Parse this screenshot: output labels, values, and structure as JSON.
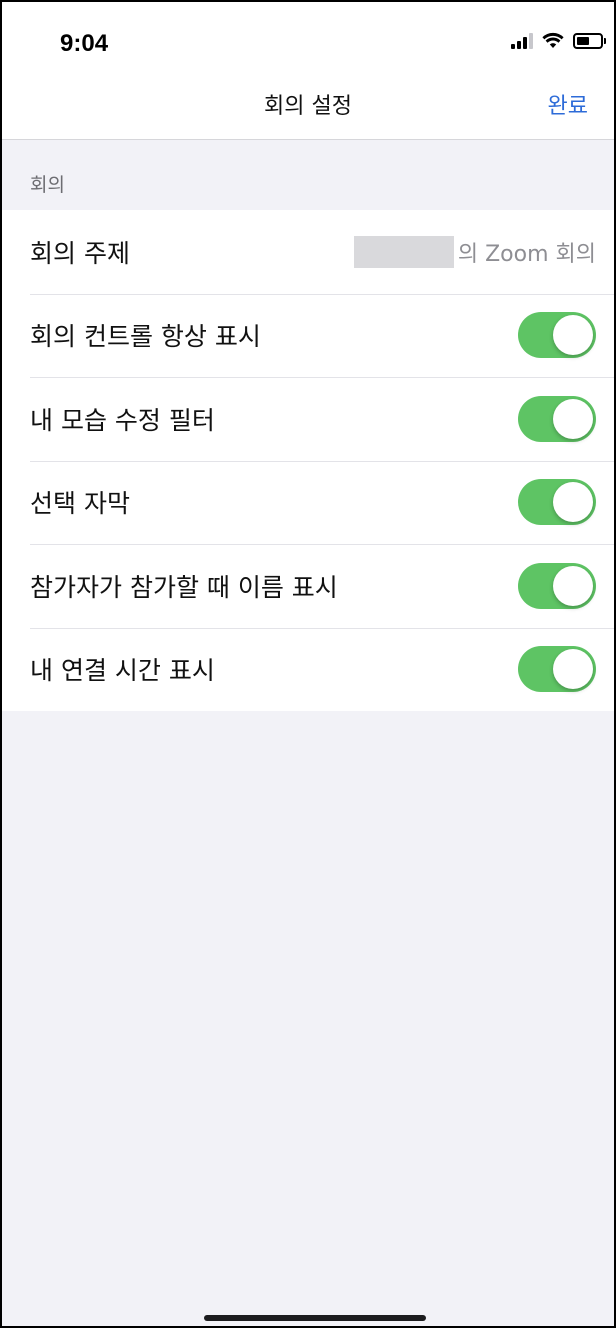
{
  "status_bar": {
    "time": "9:04",
    "icons": [
      "cellular-signal-icon",
      "wifi-icon",
      "battery-icon"
    ]
  },
  "nav": {
    "title": "회의 설정",
    "done_label": "완료"
  },
  "section": {
    "header": "회의"
  },
  "rows": [
    {
      "label": "회의 주제",
      "value": "의 Zoom 회의",
      "type": "value"
    },
    {
      "label": "회의 컨트롤 항상 표시",
      "type": "toggle",
      "on": true
    },
    {
      "label": "내 모습 수정 필터",
      "type": "toggle",
      "on": true
    },
    {
      "label": "선택 자막",
      "type": "toggle",
      "on": true
    },
    {
      "label": "참가자가 참가할 때 이름 표시",
      "type": "toggle",
      "on": true
    },
    {
      "label": "내 연결 시간 표시",
      "type": "toggle",
      "on": true
    }
  ],
  "colors": {
    "accent": "#2d6bd8",
    "toggle_on": "#5ec464",
    "background": "#f2f2f7"
  }
}
